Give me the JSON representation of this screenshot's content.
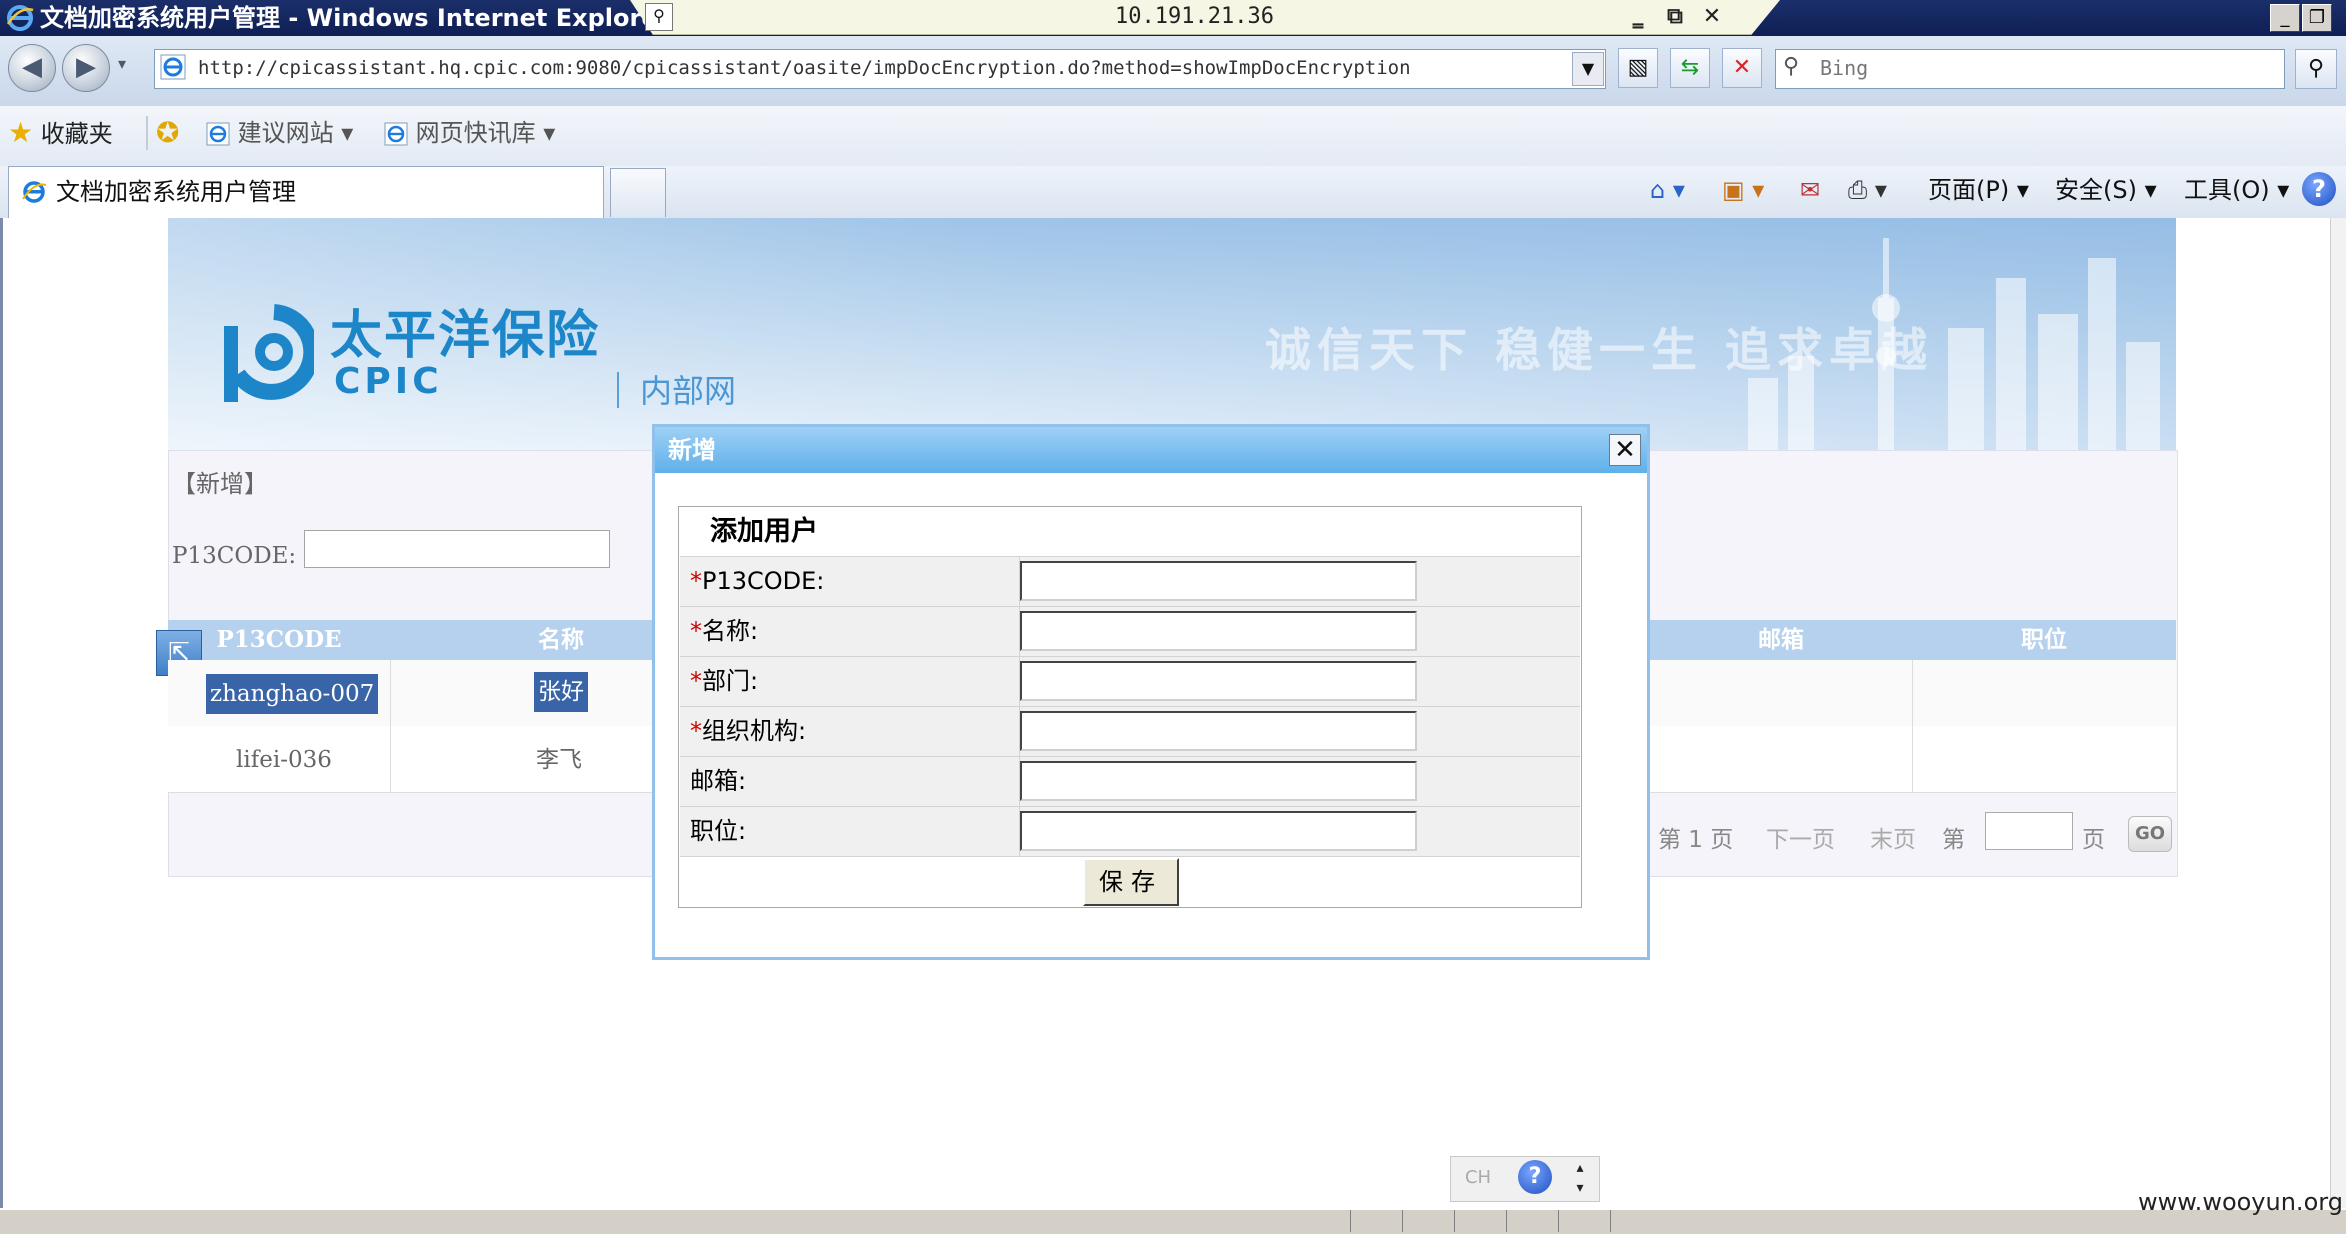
{
  "window": {
    "title": "文档加密系统用户管理 - Windows Internet Explorer",
    "remote_ip": "10.191.21.36",
    "remote_minimize": "‗",
    "remote_restore": "⧉",
    "remote_close": "✕"
  },
  "address_bar": {
    "url": "http://cpicassistant.hq.cpic.com:9080/cpicassistant/oasite/impDocEncryption.do?method=showImpDocEncryption",
    "search_placeholder": "Bing"
  },
  "favorites_bar": {
    "favorites_label": "收藏夹",
    "items": [
      {
        "label": "建议网站 ▾"
      },
      {
        "label": "网页快讯库 ▾"
      }
    ]
  },
  "tabs": {
    "active_label": "文档加密系统用户管理"
  },
  "command_bar": {
    "page_menu": "页面(P) ▾",
    "safety_menu": "安全(S) ▾",
    "tools_menu": "工具(O) ▾"
  },
  "page": {
    "brand_cn": "太平洋保险",
    "brand_en": "CPIC",
    "intranet": "内部网",
    "slogan": "诚信天下 稳健一生 追求卓越",
    "section_label": "【新增】",
    "filter_label": "P13CODE:",
    "table": {
      "headers": [
        "P13CODE",
        "名称",
        "邮箱",
        "职位"
      ],
      "rows": [
        {
          "code": "zhanghao-007",
          "name": "张好"
        },
        {
          "code": "lifei-036",
          "name": "李飞"
        }
      ]
    },
    "pager": {
      "page_info": "第 1 页",
      "next": "下一页",
      "last": "末页",
      "goto_prefix": "第",
      "goto_suffix": "页",
      "go": "GO"
    }
  },
  "dialog": {
    "title": "新增",
    "form_title": "添加用户",
    "fields": [
      {
        "required": "*",
        "label": "P13CODE:",
        "value": ""
      },
      {
        "required": "*",
        "label": "名称:",
        "value": ""
      },
      {
        "required": "*",
        "label": "部门:",
        "value": ""
      },
      {
        "required": "*",
        "label": "组织机构:",
        "value": ""
      },
      {
        "required": "",
        "label": "邮箱:",
        "value": ""
      },
      {
        "required": "",
        "label": "职位:",
        "value": ""
      }
    ],
    "save_label": "保存"
  },
  "language_bar": {
    "lang": "CH",
    "help": "?"
  },
  "watermark": "www.wooyun.org"
}
